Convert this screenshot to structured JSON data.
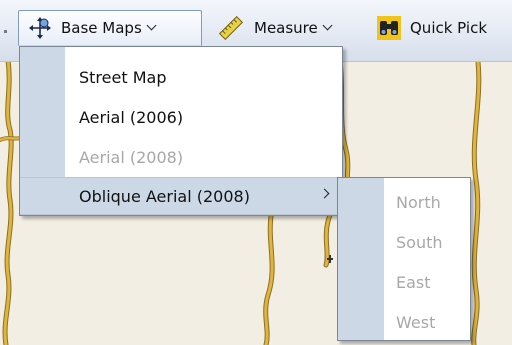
{
  "toolbar": {
    "base_maps_label": "Base Maps",
    "measure_label": "Measure",
    "quick_pick_label": "Quick Pick"
  },
  "base_maps_menu": {
    "items": [
      {
        "label": "Street Map",
        "enabled": true
      },
      {
        "label": "Aerial (2006)",
        "enabled": true
      },
      {
        "label": "Aerial (2008)",
        "enabled": false
      },
      {
        "label": "Oblique Aerial (2008)",
        "enabled": true,
        "has_submenu": true,
        "highlighted": true
      }
    ]
  },
  "oblique_submenu": {
    "items": [
      {
        "label": "North",
        "enabled": false
      },
      {
        "label": "South",
        "enabled": false
      },
      {
        "label": "East",
        "enabled": false
      },
      {
        "label": "West",
        "enabled": false
      }
    ]
  },
  "icons": {
    "base_maps": "pan-arrows-icon",
    "measure": "ruler-icon",
    "quick_pick": "binoculars-icon"
  },
  "colors": {
    "menu_gutter": "#cdd8e6",
    "menu_highlight": "#cdd8e6",
    "disabled_text": "#a8a8a8",
    "map_background": "#f3eee3",
    "road": "#d8b13a"
  }
}
